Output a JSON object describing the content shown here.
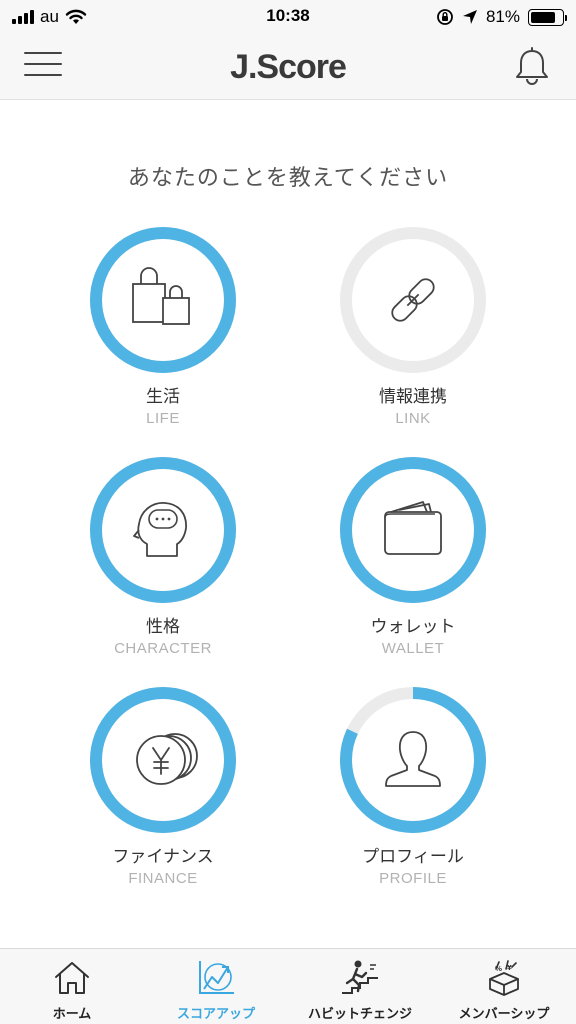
{
  "status_bar": {
    "carrier": "au",
    "time": "10:38",
    "battery": "81%",
    "battery_level": 0.81
  },
  "header": {
    "title": "J.Score"
  },
  "main": {
    "prompt": "あなたのことを教えてください",
    "accent_color": "#4fb3e3",
    "track_color": "#ebebeb",
    "categories": [
      {
        "label": "生活",
        "sub": "LIFE",
        "icon": "shopping-bags-icon",
        "progress": 1.0
      },
      {
        "label": "情報連携",
        "sub": "LINK",
        "icon": "link-icon",
        "progress": 0.0
      },
      {
        "label": "性格",
        "sub": "CHARACTER",
        "icon": "head-thought-icon",
        "progress": 1.0
      },
      {
        "label": "ウォレット",
        "sub": "WALLET",
        "icon": "wallet-icon",
        "progress": 1.0
      },
      {
        "label": "ファイナンス",
        "sub": "FINANCE",
        "icon": "yen-coins-icon",
        "progress": 1.0
      },
      {
        "label": "プロフィール",
        "sub": "PROFILE",
        "icon": "person-icon",
        "progress": 0.82
      }
    ]
  },
  "tabbar": {
    "tabs": [
      {
        "label": "ホーム",
        "icon": "home-icon",
        "active": false
      },
      {
        "label": "スコアアップ",
        "icon": "score-up-chart-icon",
        "active": true
      },
      {
        "label": "ハビットチェンジ",
        "icon": "habit-change-stairs-icon",
        "active": false
      },
      {
        "label": "メンバーシップ",
        "icon": "membership-gift-icon",
        "active": false
      }
    ]
  }
}
